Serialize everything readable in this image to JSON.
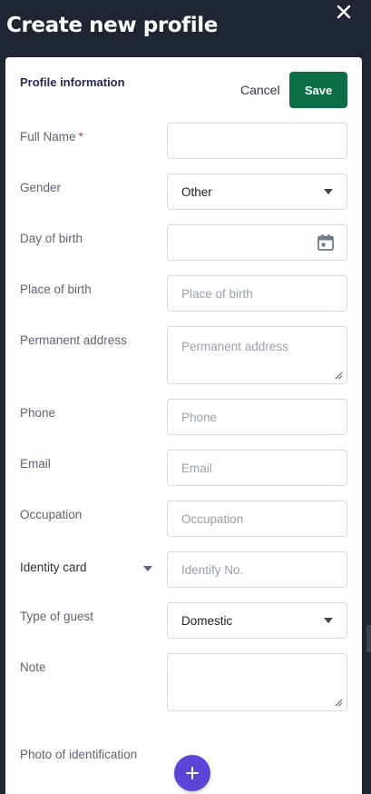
{
  "header": {
    "title": "Create new profile",
    "close_icon": "close-icon"
  },
  "form": {
    "section_title": "Profile information",
    "cancel_label": "Cancel",
    "save_label": "Save",
    "fields": {
      "full_name": {
        "label": "Full Name",
        "required_mark": "*",
        "value": ""
      },
      "gender": {
        "label": "Gender",
        "value": "Other"
      },
      "day_of_birth": {
        "label": "Day of birth",
        "value": "",
        "icon": "calendar-icon"
      },
      "place_of_birth": {
        "label": "Place of birth",
        "placeholder": "Place of birth"
      },
      "permanent_address": {
        "label": "Permanent address",
        "placeholder": "Permanent address"
      },
      "phone": {
        "label": "Phone",
        "placeholder": "Phone"
      },
      "email": {
        "label": "Email",
        "placeholder": "Email"
      },
      "occupation": {
        "label": "Occupation",
        "placeholder": "Occupation"
      },
      "identity": {
        "type_value": "Identity card",
        "placeholder": "Identify No."
      },
      "type_of_guest": {
        "label": "Type of guest",
        "value": "Domestic"
      },
      "note": {
        "label": "Note",
        "value": ""
      },
      "photo": {
        "label": "Photo of identification",
        "icon": "plus-icon"
      }
    }
  },
  "colors": {
    "background": "#1f2532",
    "save_button": "#0b6e45",
    "add_button": "#5b45d6",
    "section_title": "#28285a",
    "required": "#d93a3a"
  }
}
